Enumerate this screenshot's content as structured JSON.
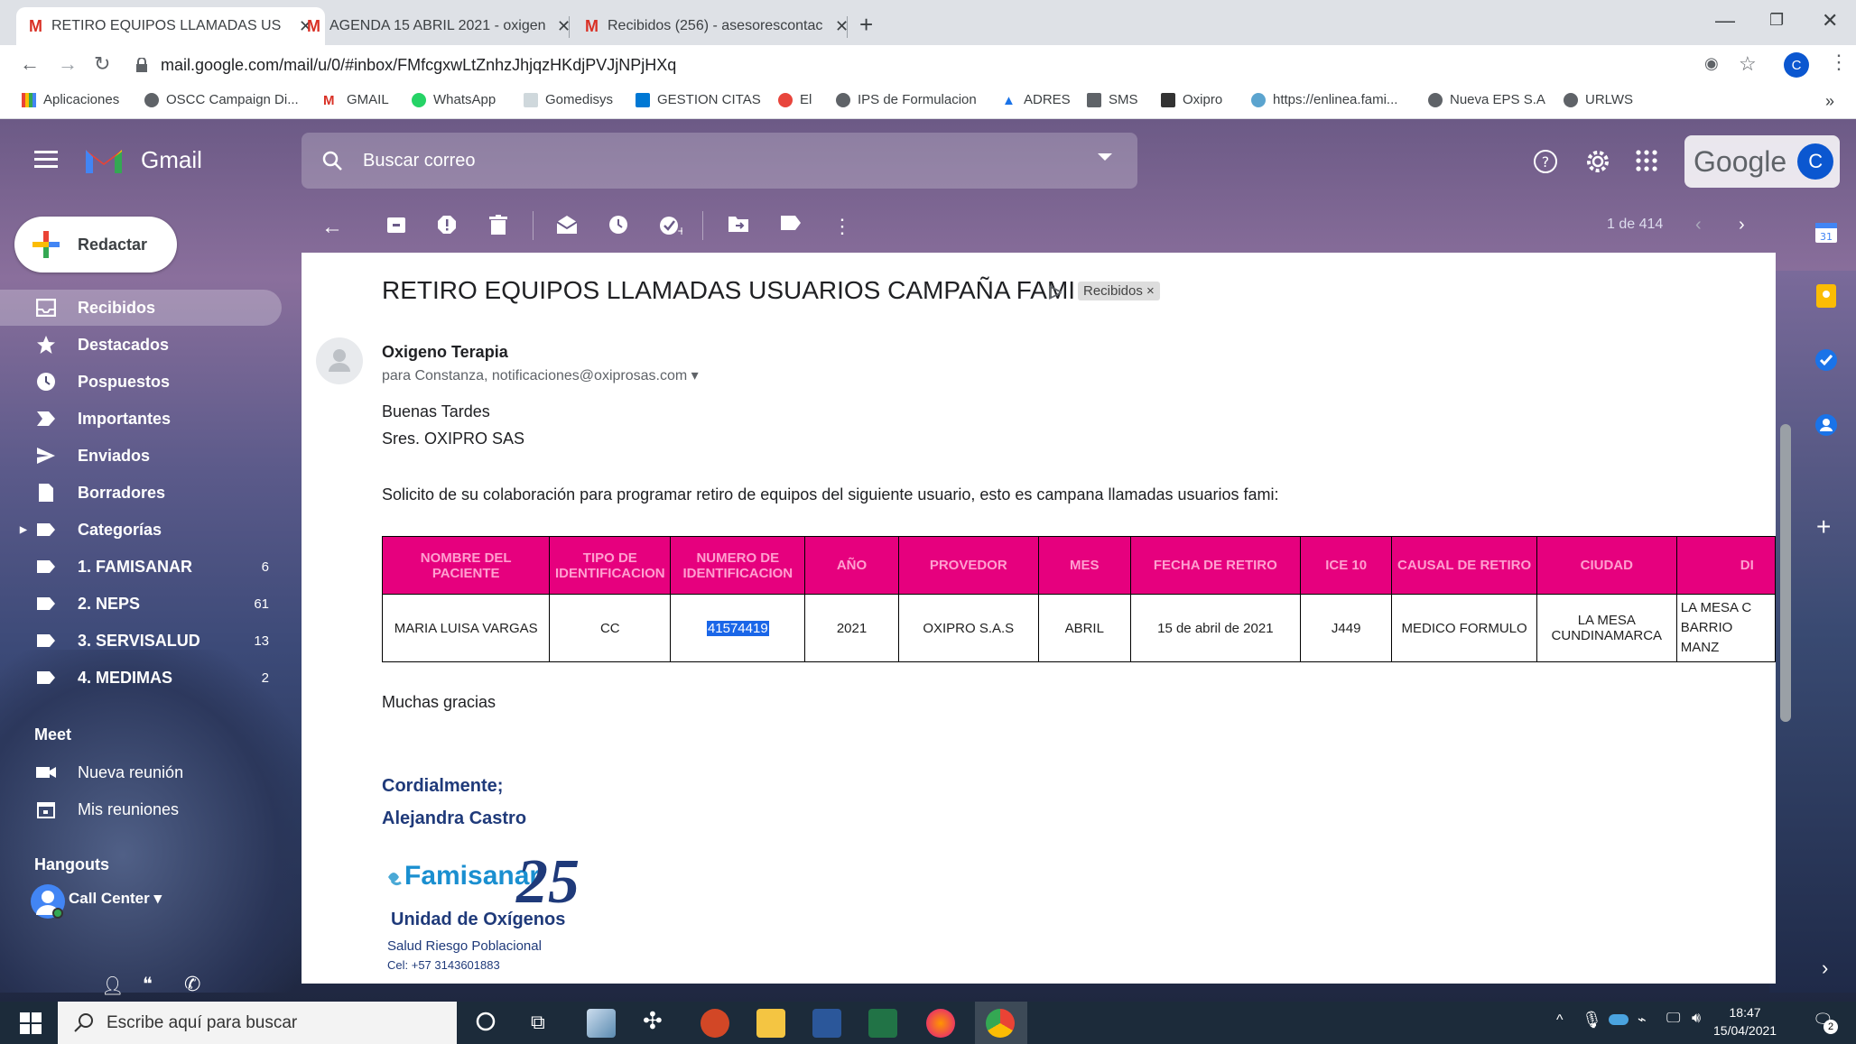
{
  "browser": {
    "tabs": [
      {
        "label": "RETIRO EQUIPOS LLAMADAS US",
        "icon": "gmail-m-icon"
      },
      {
        "label": "AGENDA 15 ABRIL 2021 - oxigen",
        "icon": "gmail-m-icon"
      },
      {
        "label": "Recibidos (256) - asesorescontac",
        "icon": "gmail-m-icon"
      }
    ],
    "url": "mail.google.com/mail/u/0/#inbox/FMfcgxwLtZnhzJhjqzHKdjPVJjNPjHXq",
    "bookmarks": [
      "Aplicaciones",
      "OSCC Campaign Di...",
      "GMAIL",
      "WhatsApp",
      "Gomedisys",
      "GESTION CITAS",
      "El",
      "IPS de Formulacion",
      "ADRES",
      "SMS",
      "Oxipro",
      "https://enlinea.fami...",
      "Nueva EPS S.A",
      "URLWS"
    ],
    "profile_initial": "C"
  },
  "gmail": {
    "brand": "Gmail",
    "search_placeholder": "Buscar correo",
    "google_label": "Google",
    "account_initial": "C",
    "compose_label": "Redactar",
    "nav": [
      {
        "label": "Recibidos",
        "icon": "inbox-icon"
      },
      {
        "label": "Destacados",
        "icon": "star-icon"
      },
      {
        "label": "Pospuestos",
        "icon": "clock-icon"
      },
      {
        "label": "Importantes",
        "icon": "important-icon"
      },
      {
        "label": "Enviados",
        "icon": "send-icon"
      },
      {
        "label": "Borradores",
        "icon": "draft-icon"
      },
      {
        "label": "Categorías",
        "icon": "label-icon"
      },
      {
        "label": "1. FAMISANAR",
        "count": "6",
        "icon": "label-icon"
      },
      {
        "label": "2. NEPS",
        "count": "61",
        "icon": "label-icon"
      },
      {
        "label": "3. SERVISALUD",
        "count": "13",
        "icon": "label-icon"
      },
      {
        "label": "4. MEDIMAS",
        "count": "2",
        "icon": "label-icon"
      }
    ],
    "meet": {
      "title": "Meet",
      "new": "Nueva reunión",
      "mine": "Mis reuniones"
    },
    "hangouts": {
      "title": "Hangouts",
      "user": "Call Center"
    },
    "pager": "1 de 414"
  },
  "email": {
    "subject": "RETIRO EQUIPOS LLAMADAS USUARIOS CAMPAÑA FAMI",
    "label": "Recibidos",
    "sender": "Oxigeno Terapia",
    "recipients": "para Constanza, notificaciones@oxiprosas.com",
    "greeting": "Buenas Tardes",
    "addressee": "Sres. OXIPRO SAS",
    "request": "Solicito de su colaboración para programar retiro de equipos del siguiente usuario, esto es campana llamadas usuarios fami:",
    "table": {
      "headers": [
        "NOMBRE DEL PACIENTE",
        "TIPO DE IDENTIFICACION",
        "NUMERO DE IDENTIFICACION",
        "AÑO",
        "PROVEDOR",
        "MES",
        "FECHA DE RETIRO",
        "ICE 10",
        "CAUSAL DE RETIRO",
        "CIUDAD",
        "DI"
      ],
      "row": [
        "MARIA LUISA VARGAS",
        "CC",
        "41574419",
        "2021",
        "OXIPRO S.A.S",
        "ABRIL",
        "15 de abril de 2021",
        "J449",
        "MEDICO FORMULO",
        "LA MESA CUNDINAMARCA",
        "LA MESA C BARRIO MANZ"
      ]
    },
    "thanks": "Muchas gracias",
    "closing": "Cordialmente;",
    "signer": "Alejandra Castro",
    "logo_text": "Famisanar",
    "logo_number": "25",
    "unit": "Unidad de Oxígenos",
    "dept": "Salud Riesgo Poblacional",
    "phone": "Cel: +57 3143601883"
  },
  "taskbar": {
    "search_placeholder": "Escribe aquí para buscar",
    "time": "18:47",
    "date": "15/04/2021",
    "notif_count": "2"
  }
}
